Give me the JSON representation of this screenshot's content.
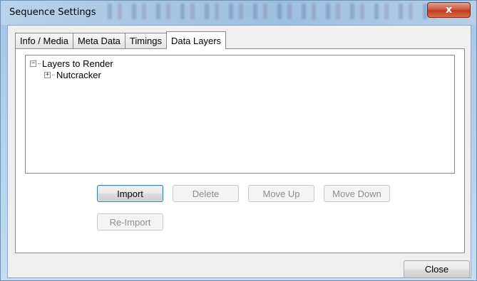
{
  "window": {
    "title": "Sequence Settings",
    "close_glyph": "x"
  },
  "tabs": [
    {
      "label": "Info / Media"
    },
    {
      "label": "Meta Data"
    },
    {
      "label": "Timings"
    },
    {
      "label": "Data Layers"
    }
  ],
  "tree": {
    "root": {
      "label": "Layers to Render",
      "expander": "−"
    },
    "children": [
      {
        "label": "Nutcracker",
        "expander": "+"
      }
    ]
  },
  "buttons": {
    "import": "Import",
    "delete": "Delete",
    "move_up": "Move Up",
    "move_down": "Move Down",
    "reimport": "Re-Import",
    "close": "Close"
  }
}
